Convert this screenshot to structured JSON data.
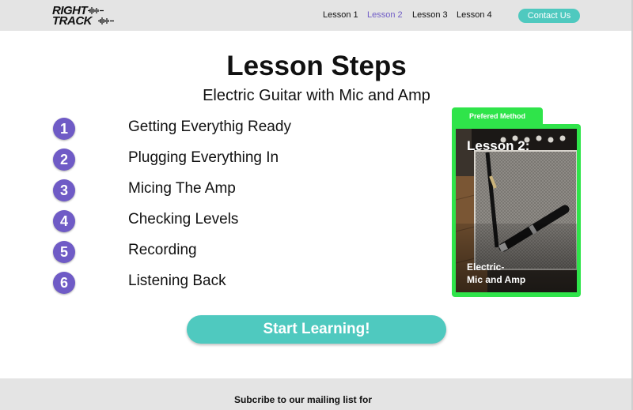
{
  "header": {
    "logo": {
      "line1": "RIGHT",
      "line2": "TRACK"
    },
    "nav": [
      "Lesson 1",
      "Lesson 2",
      "Lesson 3",
      "Lesson 4"
    ],
    "active_nav": "Lesson 2",
    "contact_label": "Contact Us"
  },
  "main": {
    "title": "Lesson Steps",
    "subtitle": "Electric Guitar with Mic and Amp",
    "steps": [
      {
        "number": "1",
        "label": "Getting Everythig Ready"
      },
      {
        "number": "2",
        "label": "Plugging Everything In"
      },
      {
        "number": "3",
        "label": "Micing The Amp"
      },
      {
        "number": "4",
        "label": "Checking Levels"
      },
      {
        "number": "5",
        "label": "Recording"
      },
      {
        "number": "6",
        "label": "Listening Back"
      }
    ],
    "cta_label": "Start Learning!"
  },
  "card": {
    "tab_label": "Prefered Method",
    "title": "Lesson 2:",
    "caption_line1": "Electric-",
    "caption_line2": "Mic and Amp"
  },
  "footer": {
    "text": "Subcribe to our mailing list for"
  },
  "colors": {
    "accent_purple": "#6f5bc6",
    "accent_teal": "#4fc9bf",
    "accent_green": "#2fe44a",
    "header_gray": "#e4e4e4"
  }
}
